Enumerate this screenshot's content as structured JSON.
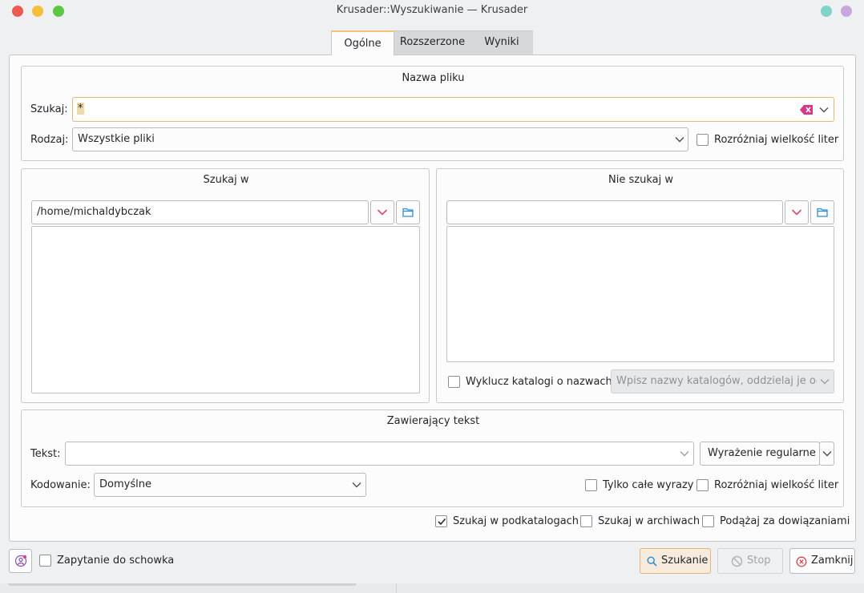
{
  "window": {
    "title": "Krusader::Wyszukiwanie — Krusader",
    "controls": {
      "close_color": "#ee5a52",
      "minimize_color": "#f5bf3b",
      "maximize_color": "#5bc745",
      "right_dot1": "#7fd3c8",
      "right_dot2": "#c8a8dc"
    }
  },
  "tabs": [
    {
      "label": "Ogólne",
      "active": true
    },
    {
      "label": "Rozszerzone",
      "active": false
    },
    {
      "label": "Wyniki",
      "active": false
    }
  ],
  "name_group": {
    "title": "Nazwa pliku",
    "search_label": "Szukaj:",
    "search_value": "*",
    "kind_label": "Rodzaj:",
    "kind_value": "Wszystkie pliki",
    "case_label": "Rozróżniaj wielkość liter",
    "case_checked": false
  },
  "search_in": {
    "title": "Szukaj w",
    "path": "/home/michaldybczak"
  },
  "dont_search_in": {
    "title": "Nie szukaj w",
    "path": "",
    "exclude_label": "Wyklucz katalogi o nazwach",
    "exclude_checked": false,
    "exclude_placeholder": "Wpisz nazwy katalogów, oddzielaj je od..."
  },
  "content_group": {
    "title": "Zawierający tekst",
    "text_label": "Tekst:",
    "text_value": "",
    "mode_value": "Wyrażenie regularne",
    "encoding_label": "Kodowanie:",
    "encoding_value": "Domyślne",
    "whole_words_label": "Tylko całe wyrazy",
    "whole_words_checked": false,
    "case_label": "Rozróżniaj wielkość liter",
    "case_checked": false
  },
  "options": {
    "subdirs_label": "Szukaj w podkatalogach",
    "subdirs_checked": true,
    "archives_label": "Szukaj w archiwach",
    "archives_checked": false,
    "symlinks_label": "Podążaj za dowiązaniami",
    "symlinks_checked": false
  },
  "bottom": {
    "clipboard_label": "Zapytanie do schowka",
    "clipboard_checked": false,
    "search_button": "Szukanie",
    "stop_button": "Stop",
    "close_button": "Zamknij"
  },
  "colors": {
    "accent": "#f0c27a",
    "clear_icon": "#d6388a",
    "chevron_red": "#d24b67",
    "folder_blue": "#2f8fd8"
  }
}
